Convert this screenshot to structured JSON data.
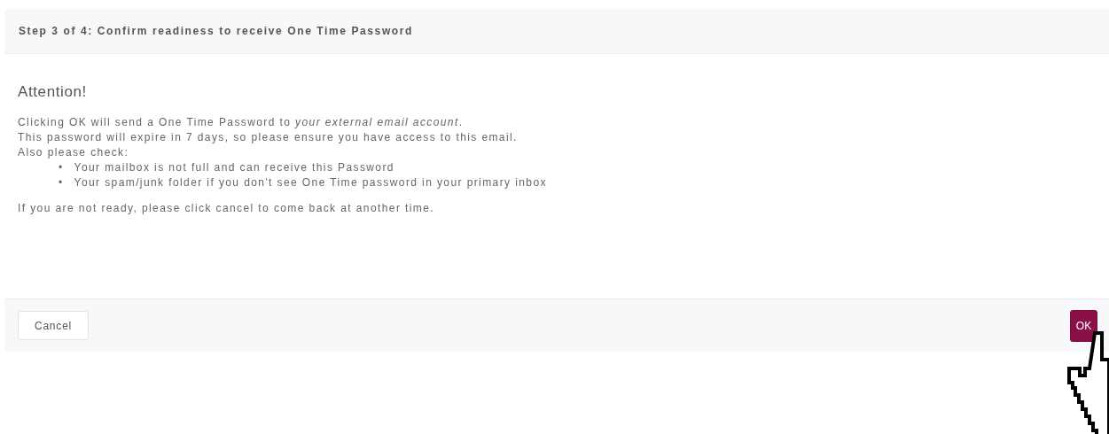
{
  "header": {
    "title": "Step 3 of 4: Confirm readiness to receive One Time Password"
  },
  "body": {
    "heading": "Attention!",
    "lines": [
      "Clicking OK will send a One Time Password to *your external email account*.",
      "This password will expire in 7 days, so please ensure you have access to this email.",
      "Also please check:"
    ],
    "bullets": [
      {
        "marker": "•",
        "text": "Your mailbox is not full and can receive this Password"
      },
      {
        "marker": "•",
        "text": "Your spam/junk folder if you don't see One Time password in your primary inbox"
      }
    ],
    "note": "If you are not ready, please click cancel to come back at another time."
  },
  "footer": {
    "buttons": [
      {
        "label": "Cancel",
        "kind": "secondary"
      },
      {
        "label": "OK",
        "kind": "primary"
      }
    ]
  }
}
